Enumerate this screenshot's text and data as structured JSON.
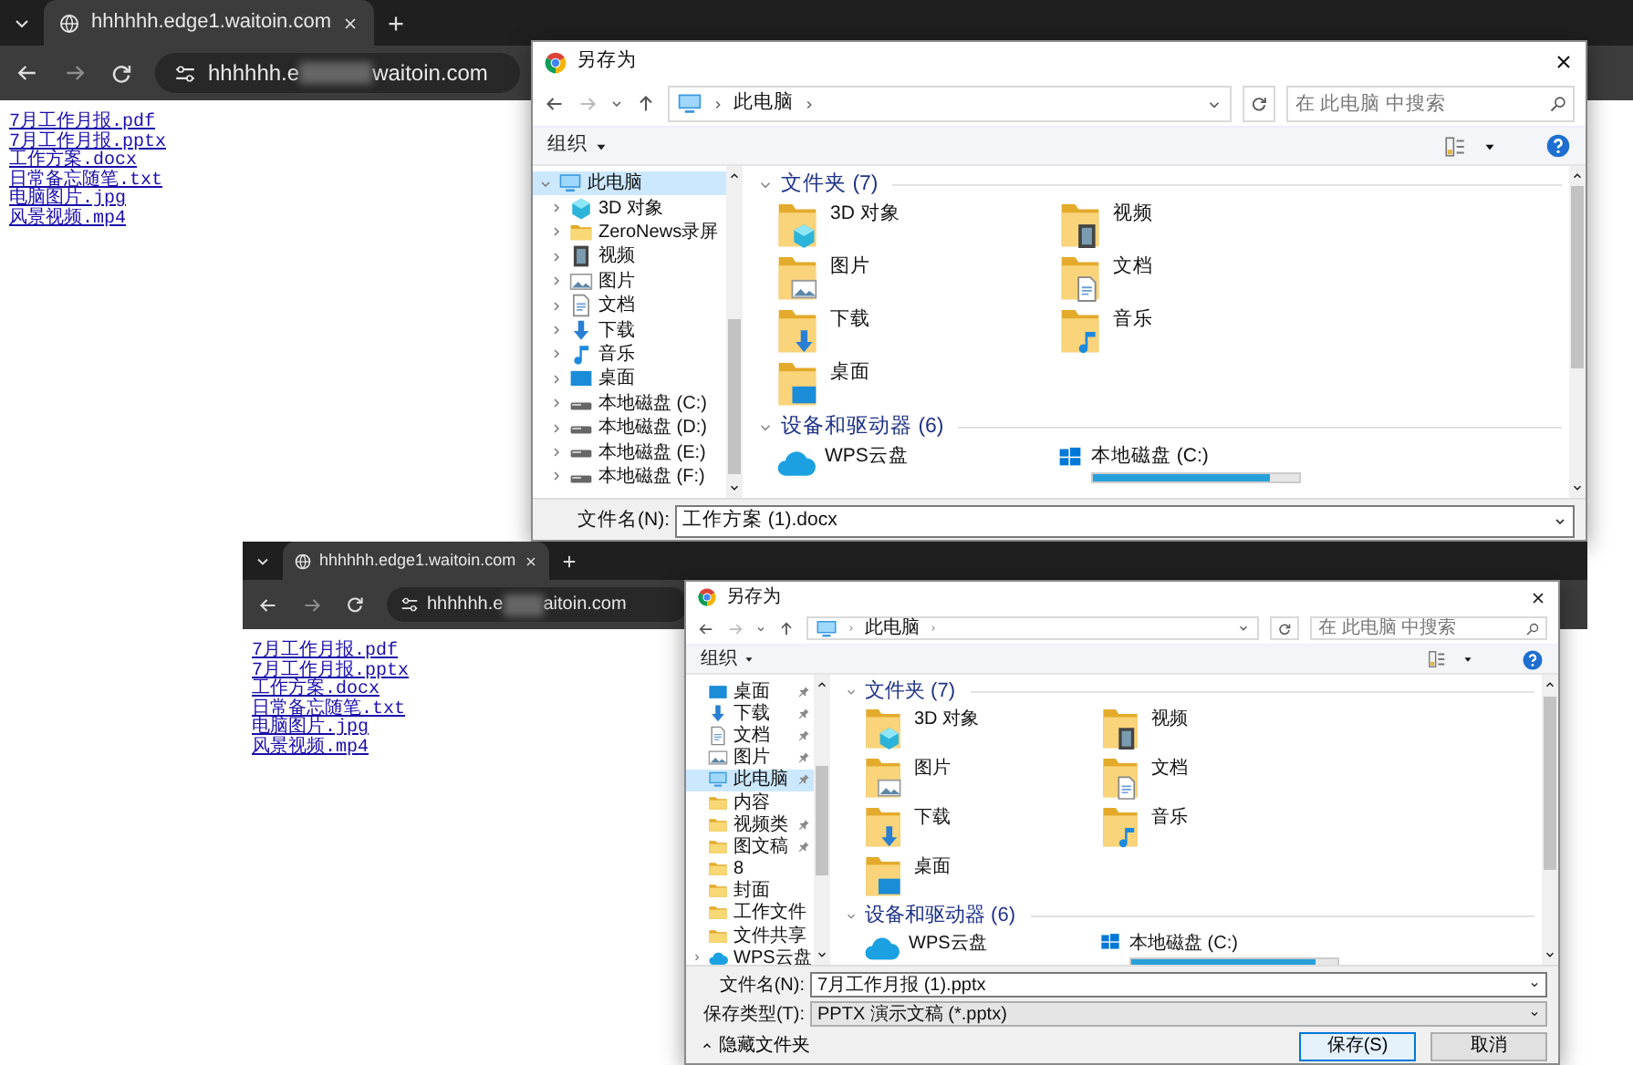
{
  "screenshots": [
    {
      "browser": {
        "tab_title": "hhhhhh.edge1.waitoin.com",
        "url_start": "hhhhhh.e",
        "url_end": "waitoin.com",
        "links": [
          "7月工作月报.pdf",
          "7月工作月报.pptx",
          "工作方案.docx",
          "日常备忘随笔.txt",
          "电脑图片.jpg",
          "风景视频.mp4"
        ]
      },
      "dialog": {
        "title": "另存为",
        "path": [
          "此电脑"
        ],
        "search_placeholder": "在 此电脑 中搜索",
        "organize": "组织",
        "sidebar": [
          {
            "label": "此电脑",
            "kind": "pc",
            "selected": true,
            "expanded": true,
            "children": [
              {
                "label": "3D 对象",
                "kind": "cube",
                "selected": false,
                "expanded": false
              },
              {
                "label": "ZeroNews录屏",
                "kind": "folder",
                "selected": false,
                "expanded": false
              },
              {
                "label": "视频",
                "kind": "film",
                "selected": false,
                "expanded": false
              },
              {
                "label": "图片",
                "kind": "picture",
                "selected": false,
                "expanded": false
              },
              {
                "label": "文档",
                "kind": "doc",
                "selected": false,
                "expanded": false
              },
              {
                "label": "下载",
                "kind": "download",
                "selected": false,
                "expanded": false
              },
              {
                "label": "音乐",
                "kind": "music",
                "selected": false,
                "expanded": false
              },
              {
                "label": "桌面",
                "kind": "desktop",
                "selected": false,
                "expanded": false
              },
              {
                "label": "本地磁盘 (C:)",
                "kind": "drive",
                "selected": false,
                "expanded": false
              },
              {
                "label": "本地磁盘 (D:)",
                "kind": "drive",
                "selected": false,
                "expanded": false
              },
              {
                "label": "本地磁盘 (E:)",
                "kind": "drive",
                "selected": false,
                "expanded": false
              },
              {
                "label": "本地磁盘 (F:)",
                "kind": "drive",
                "selected": false,
                "expanded": false
              }
            ]
          }
        ],
        "sections": [
          {
            "title": "文件夹 (7)",
            "expanded": true,
            "items": [
              {
                "label": "3D 对象",
                "kind": "cube"
              },
              {
                "label": "视频",
                "kind": "film"
              },
              {
                "label": "图片",
                "kind": "picture"
              },
              {
                "label": "文档",
                "kind": "doc"
              },
              {
                "label": "下载",
                "kind": "download"
              },
              {
                "label": "音乐",
                "kind": "music"
              },
              {
                "label": "桌面",
                "kind": "desktop"
              }
            ]
          },
          {
            "title": "设备和驱动器 (6)",
            "expanded": true,
            "items": [
              {
                "label": "WPS云盘",
                "kind": "cloud"
              },
              {
                "label": "本地磁盘 (C:)",
                "kind": "drive",
                "level": 0.86
              }
            ]
          }
        ],
        "fields": [
          {
            "label": "文件名(N):",
            "value": "工作方案 (1).docx",
            "kind": "combo"
          }
        ]
      }
    },
    {
      "browser": {
        "tab_title": "hhhhhh.edge1.waitoin.com",
        "url_start": "hhhhhh.e",
        "url_end": "aitoin.com",
        "links": [
          "7月工作月报.pdf",
          "7月工作月报.pptx",
          "工作方案.docx",
          "日常备忘随笔.txt",
          "电脑图片.jpg",
          "风景视频.mp4"
        ]
      },
      "dialog": {
        "title": "另存为",
        "path": [
          "此电脑"
        ],
        "search_placeholder": "在 此电脑 中搜索",
        "organize": "组织",
        "sidebar": [
          {
            "label": "桌面",
            "kind": "desktop",
            "selected": false,
            "pinned": true
          },
          {
            "label": "下载",
            "kind": "download",
            "selected": false,
            "pinned": true
          },
          {
            "label": "文档",
            "kind": "doc",
            "selected": false,
            "pinned": true
          },
          {
            "label": "图片",
            "kind": "picture",
            "selected": false,
            "pinned": true
          },
          {
            "label": "此电脑",
            "kind": "pc",
            "selected": true,
            "pinned": true
          },
          {
            "label": "内容",
            "kind": "folder",
            "selected": false,
            "pinned": false
          },
          {
            "label": "视频类",
            "kind": "folder",
            "selected": false,
            "pinned": true
          },
          {
            "label": "图文稿",
            "kind": "folder",
            "selected": false,
            "pinned": true
          },
          {
            "label": "8",
            "kind": "folder",
            "selected": false,
            "pinned": false
          },
          {
            "label": "封面",
            "kind": "folder",
            "selected": false,
            "pinned": false
          },
          {
            "label": "工作文件",
            "kind": "folder",
            "selected": false,
            "pinned": false
          },
          {
            "label": "文件共享",
            "kind": "folder",
            "selected": false,
            "pinned": false
          },
          {
            "label": "WPS云盘",
            "kind": "cloud",
            "selected": false,
            "expanded": false
          }
        ],
        "sections": [
          {
            "title": "文件夹 (7)",
            "expanded": true,
            "items": [
              {
                "label": "3D 对象",
                "kind": "cube"
              },
              {
                "label": "视频",
                "kind": "film"
              },
              {
                "label": "图片",
                "kind": "picture"
              },
              {
                "label": "文档",
                "kind": "doc"
              },
              {
                "label": "下载",
                "kind": "download"
              },
              {
                "label": "音乐",
                "kind": "music"
              },
              {
                "label": "桌面",
                "kind": "desktop"
              }
            ]
          },
          {
            "title": "设备和驱动器 (6)",
            "expanded": true,
            "items": [
              {
                "label": "WPS云盘",
                "kind": "cloud"
              },
              {
                "label": "本地磁盘 (C:)",
                "kind": "drive",
                "level": 0.89
              }
            ]
          }
        ],
        "fields": [
          {
            "label": "文件名(N):",
            "value": "7月工作月报 (1).pptx",
            "kind": "combo"
          },
          {
            "label": "保存类型(T):",
            "value": "PPTX 演示文稿 (*.pptx)",
            "kind": "select"
          }
        ],
        "hide_folders": "隐藏文件夹",
        "buttons": [
          {
            "label": "保存(S)",
            "primary": true
          },
          {
            "label": "取消",
            "primary": false
          }
        ]
      }
    }
  ]
}
